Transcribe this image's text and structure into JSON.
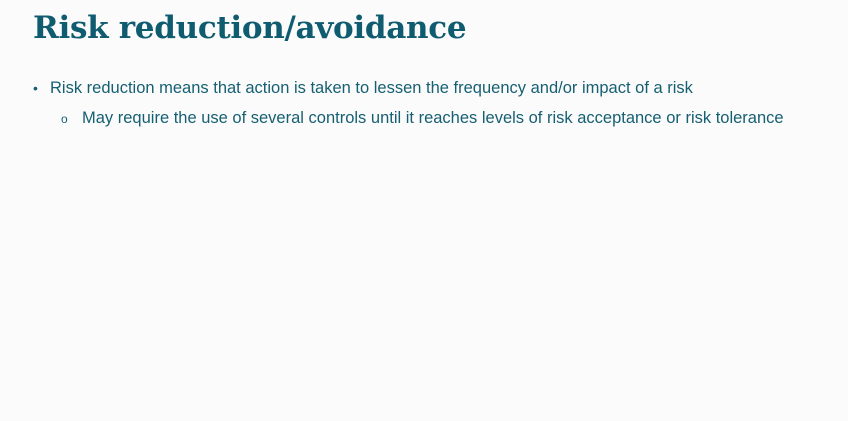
{
  "slide": {
    "title": "Risk reduction/avoidance",
    "bullets": [
      {
        "marker": "•",
        "text": "Risk reduction means that action is taken to lessen the frequency and/or impact of a risk"
      },
      {
        "marker": "o",
        "text": "May require the use of several controls until it reaches levels of risk acceptance or risk tolerance"
      }
    ]
  },
  "colors": {
    "title": "#0f5c70",
    "body_text": "#155f73",
    "background": "#fbfbfb"
  }
}
